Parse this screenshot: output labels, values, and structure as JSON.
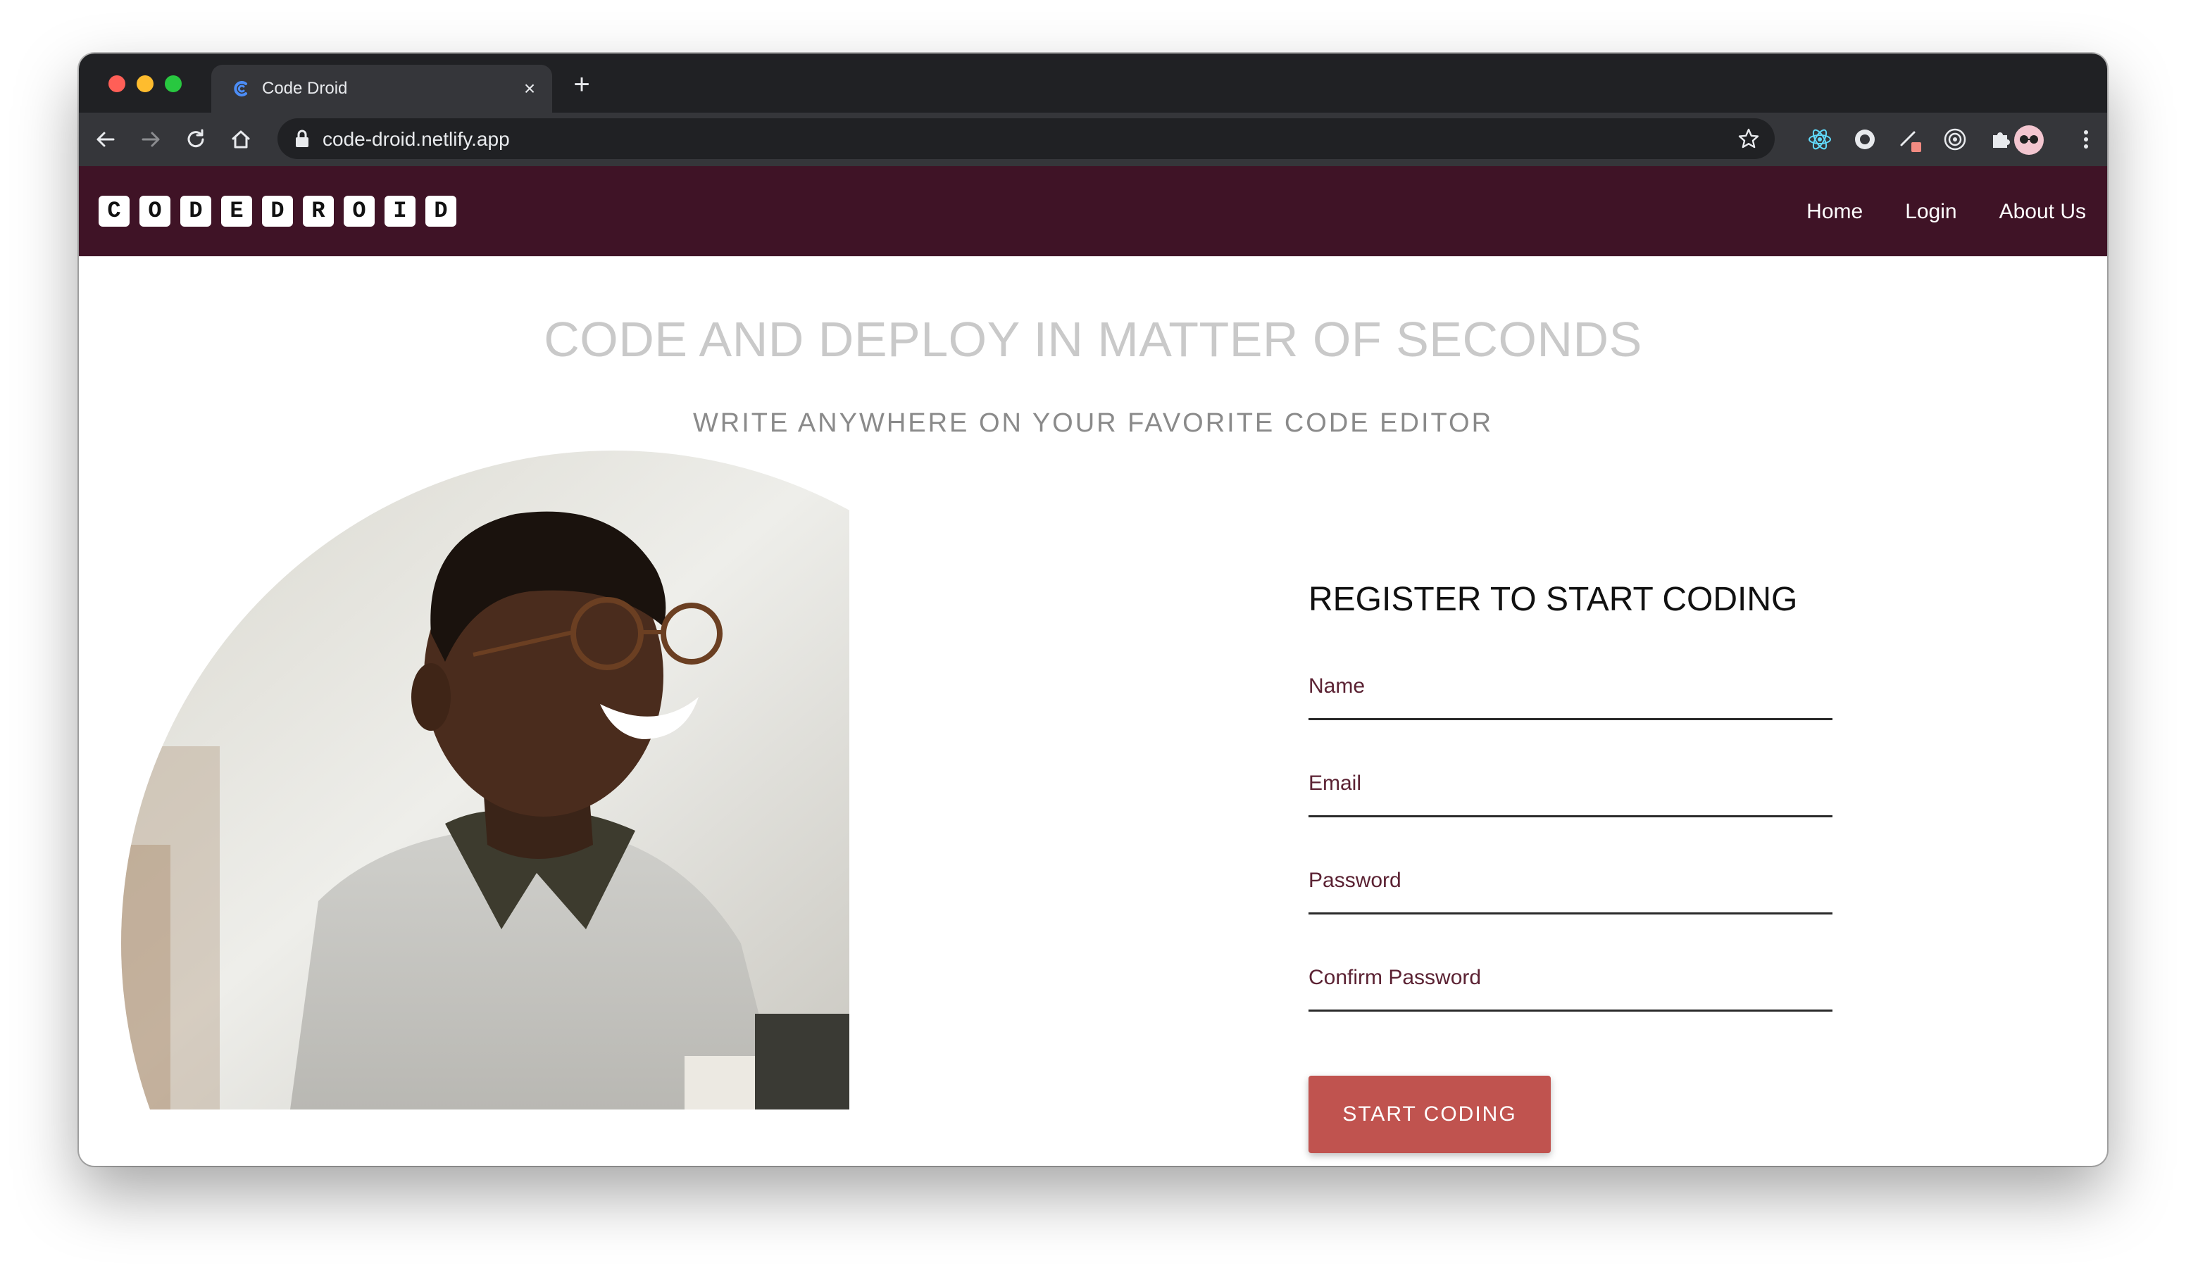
{
  "browser": {
    "tab_title": "Code Droid",
    "tab_close": "×",
    "new_tab": "+",
    "url": "code-droid.netlify.app"
  },
  "site": {
    "logo_letters": [
      "C",
      "O",
      "D",
      "E",
      "D",
      "R",
      "O",
      "I",
      "D"
    ],
    "nav": {
      "home": "Home",
      "login": "Login",
      "about": "About Us"
    },
    "colors": {
      "header_bg": "#3f1326",
      "button_bg": "#c0534f",
      "label": "#5b2233"
    }
  },
  "hero": {
    "title": "CODE AND DEPLOY IN MATTER OF SECONDS",
    "subtitle": "WRITE ANYWHERE ON YOUR FAVORITE CODE EDITOR"
  },
  "form": {
    "title": "REGISTER TO START CODING",
    "fields": {
      "name": "Name",
      "email": "Email",
      "password": "Password",
      "confirm_password": "Confirm Password"
    },
    "submit_label": "START CODING"
  }
}
